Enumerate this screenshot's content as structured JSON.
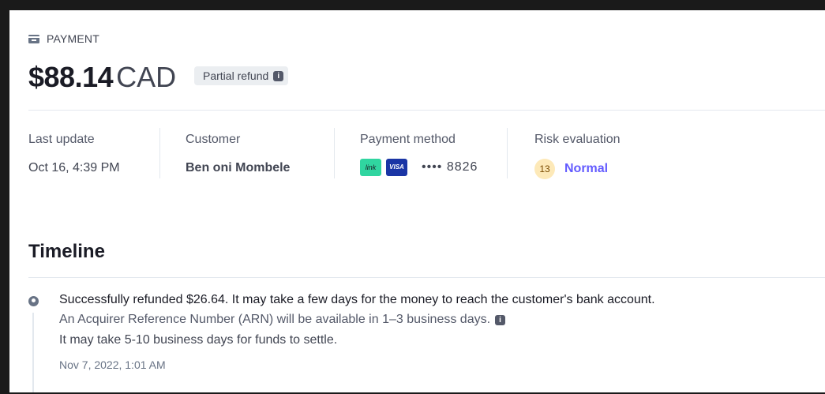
{
  "payment": {
    "section_label": "PAYMENT",
    "amount": "$88.14",
    "currency": "CAD",
    "status_badge": "Partial refund"
  },
  "details": {
    "last_update": {
      "label": "Last update",
      "value": "Oct 16, 4:39 PM"
    },
    "customer": {
      "label": "Customer",
      "value": "Ben oni Mombele"
    },
    "payment_method": {
      "label": "Payment method",
      "link_logo": "link",
      "visa_logo": "VISA",
      "masked": "•••• 8826"
    },
    "risk": {
      "label": "Risk evaluation",
      "score": "13",
      "level": "Normal"
    }
  },
  "timeline": {
    "title": "Timeline",
    "events": [
      {
        "message": "Successfully refunded $26.64. It may take a few days for the money to reach the customer's bank account.",
        "detail": "An Acquirer Reference Number (ARN) will be available in 1–3 business days.",
        "note": "It may take 5-10 business days for funds to settle.",
        "date": "Nov 7, 2022, 1:01 AM"
      }
    ]
  },
  "colors": {
    "accent": "#635bff",
    "risk_bg": "#fde9b8",
    "link_logo": "#30d5a0",
    "visa_logo": "#1a35a5"
  },
  "icons": {
    "section": "credit-card-icon",
    "info": "info-icon",
    "timeline_event": "refund-icon"
  }
}
